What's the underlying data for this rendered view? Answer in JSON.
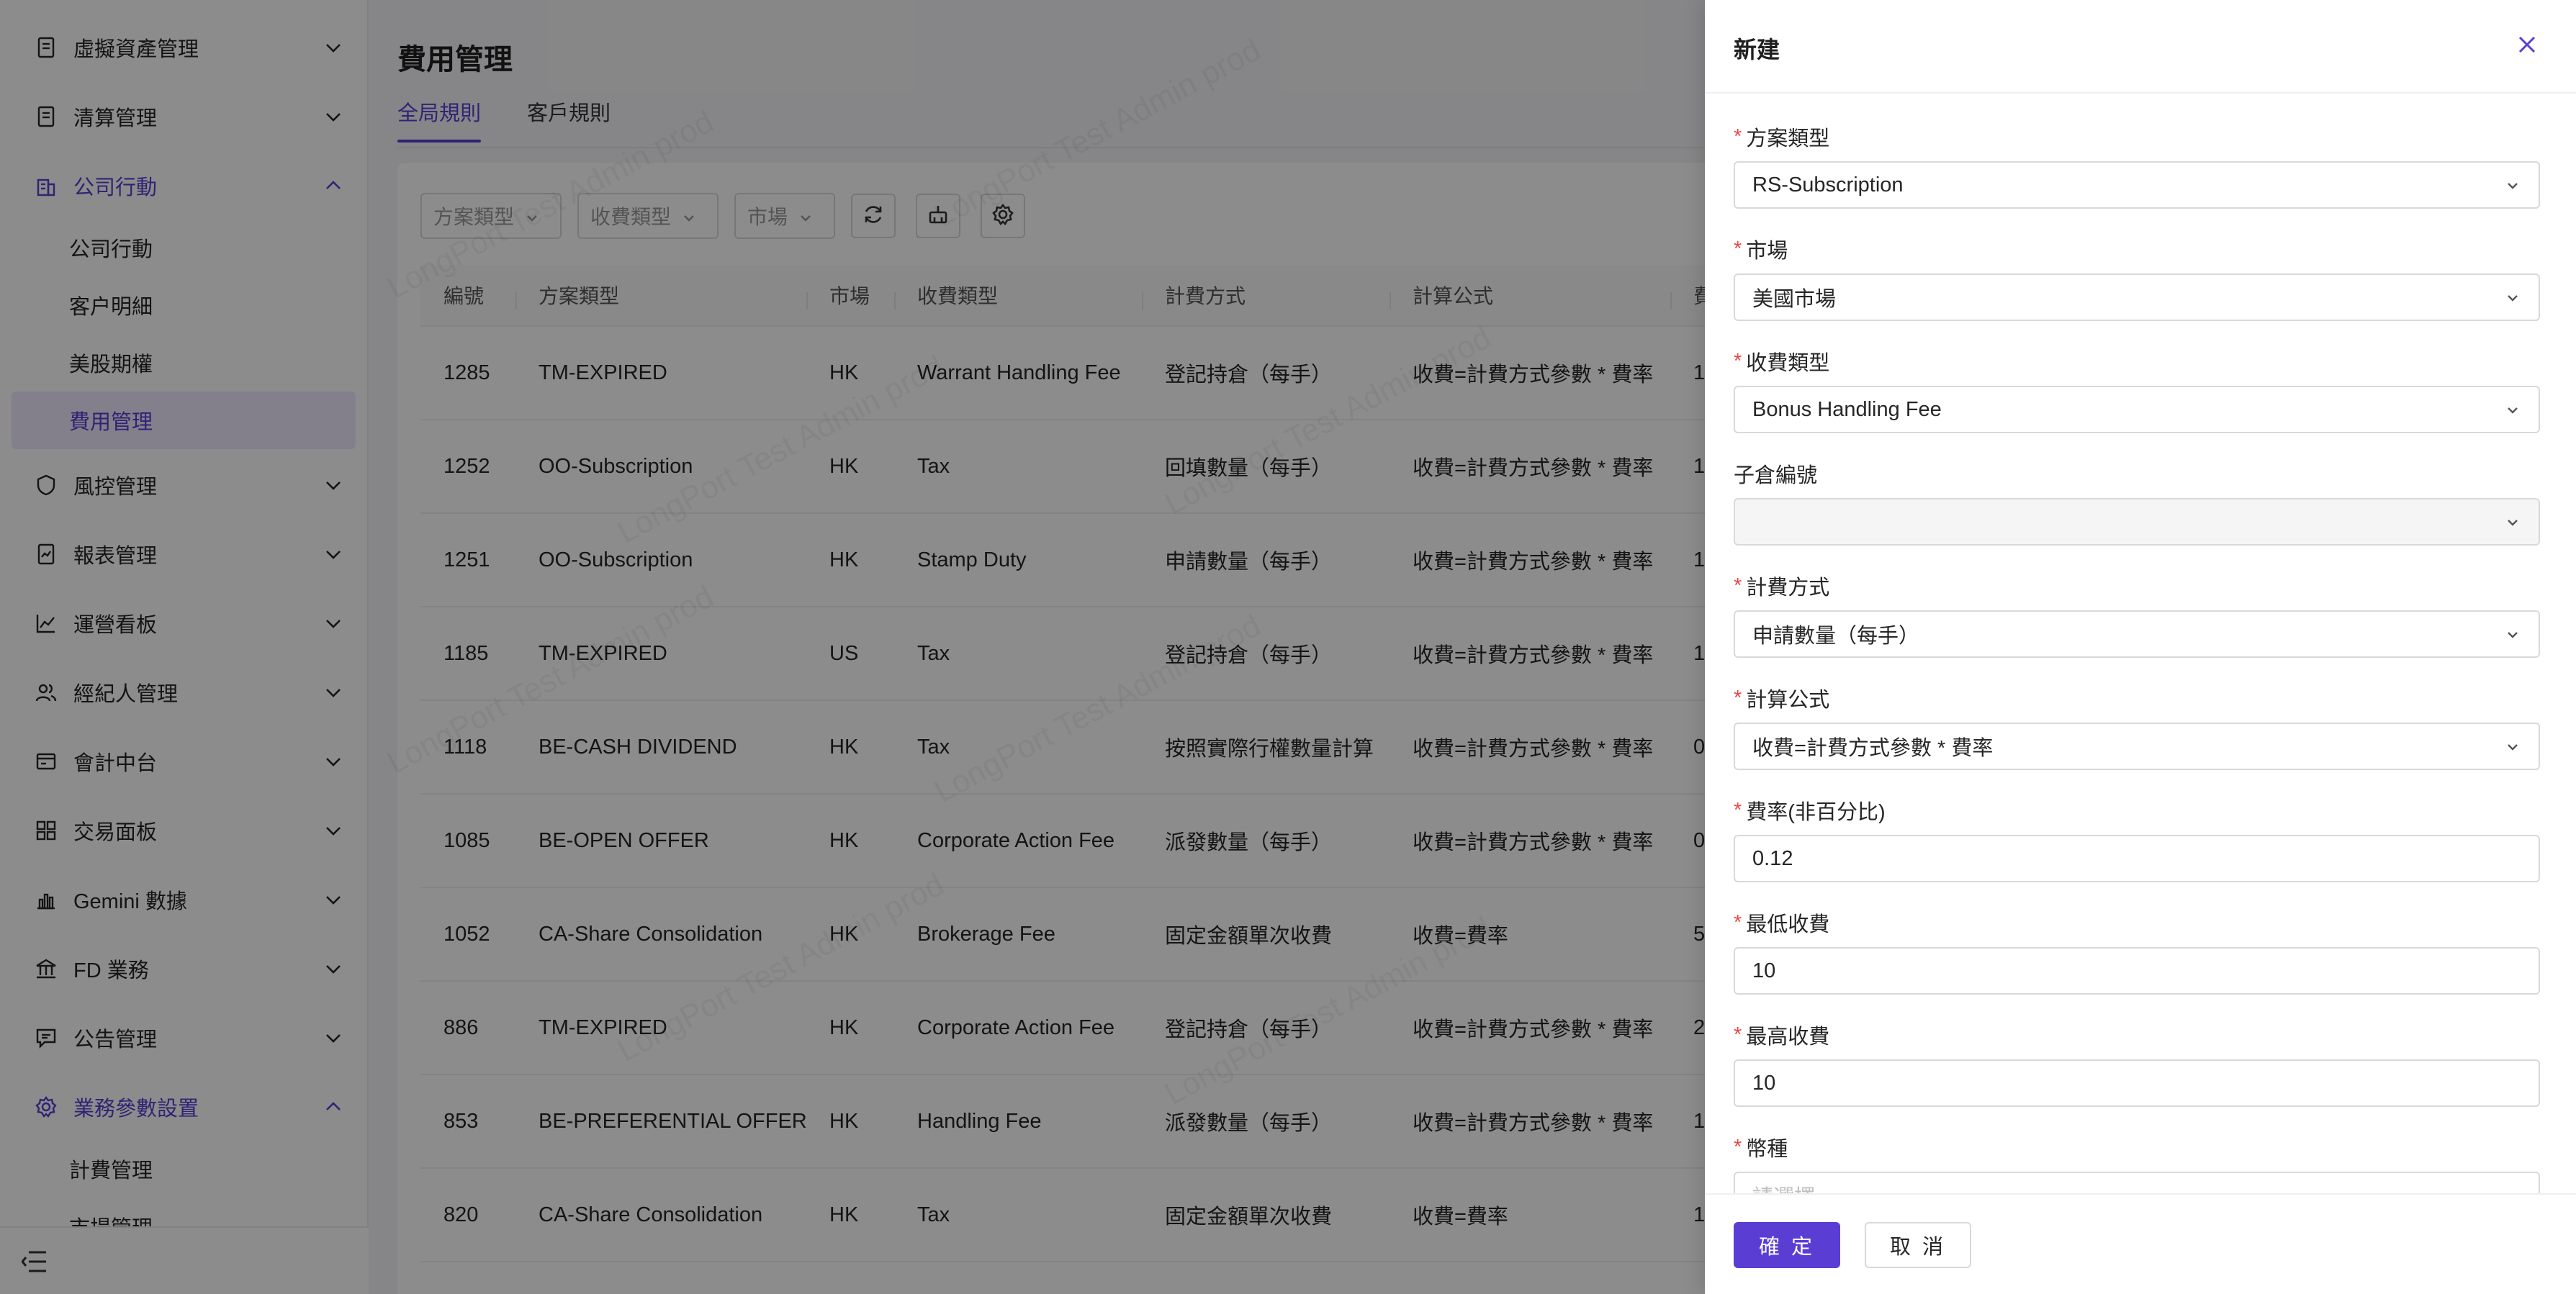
{
  "sidebar": {
    "items": [
      {
        "label": "虛擬資產管理",
        "icon": "document-icon"
      },
      {
        "label": "清算管理",
        "icon": "document-icon"
      },
      {
        "label": "公司行動",
        "icon": "building-icon",
        "open": true,
        "children": [
          "公司行動",
          "客户明細",
          "美股期權",
          "費用管理"
        ]
      },
      {
        "label": "風控管理",
        "icon": "shield-icon"
      },
      {
        "label": "報表管理",
        "icon": "report-icon"
      },
      {
        "label": "運營看板",
        "icon": "line-chart-icon"
      },
      {
        "label": "經紀人管理",
        "icon": "users-icon"
      },
      {
        "label": "會計中台",
        "icon": "ledger-icon"
      },
      {
        "label": "交易面板",
        "icon": "grid-icon"
      },
      {
        "label": "Gemini 數據",
        "icon": "bar-chart-icon"
      },
      {
        "label": "FD 業務",
        "icon": "bank-icon"
      },
      {
        "label": "公告管理",
        "icon": "message-icon"
      },
      {
        "label": "業務參數設置",
        "icon": "settings-icon",
        "open": true,
        "children": [
          "計費管理",
          "市場管理"
        ]
      }
    ],
    "active_sub": "費用管理"
  },
  "main": {
    "title": "費用管理",
    "tabs": [
      {
        "label": "全局規則",
        "active": true
      },
      {
        "label": "客戶規則",
        "active": false
      }
    ],
    "filters": [
      "方案類型",
      "收費類型",
      "市場"
    ],
    "watermark": "LongPort Test Admin prod"
  },
  "table": {
    "columns": [
      "編號",
      "方案類型",
      "市場",
      "收費類型",
      "計費方式",
      "計算公式",
      "費"
    ],
    "rows": [
      [
        "1285",
        "TM-EXPIRED",
        "HK",
        "Warrant Handling Fee",
        "登記持倉（每手）",
        "收費=計費方式參數 * 費率",
        "1"
      ],
      [
        "1252",
        "OO-Subscription",
        "HK",
        "Tax",
        "回填數量（每手）",
        "收費=計費方式參數 * 費率",
        "1"
      ],
      [
        "1251",
        "OO-Subscription",
        "HK",
        "Stamp Duty",
        "申請數量（每手）",
        "收費=計費方式參數 * 費率",
        "1"
      ],
      [
        "1185",
        "TM-EXPIRED",
        "US",
        "Tax",
        "登記持倉（每手）",
        "收費=計費方式參數 * 費率",
        "1"
      ],
      [
        "1118",
        "BE-CASH DIVIDEND",
        "HK",
        "Tax",
        "按照實際行權數量計算",
        "收費=計費方式參數 * 費率",
        "0"
      ],
      [
        "1085",
        "BE-OPEN OFFER",
        "HK",
        "Corporate Action Fee",
        "派發數量（每手）",
        "收費=計費方式參數 * 費率",
        "0"
      ],
      [
        "1052",
        "CA-Share Consolidation",
        "HK",
        "Brokerage Fee",
        "固定金額單次收費",
        "收費=費率",
        "5"
      ],
      [
        "886",
        "TM-EXPIRED",
        "HK",
        "Corporate Action Fee",
        "登記持倉（每手）",
        "收費=計費方式參數 * 費率",
        "2"
      ],
      [
        "853",
        "BE-PREFERENTIAL OFFER",
        "HK",
        "Handling Fee",
        "派發數量（每手）",
        "收費=計費方式參數 * 費率",
        "1"
      ],
      [
        "820",
        "CA-Share Consolidation",
        "HK",
        "Tax",
        "固定金額單次收費",
        "收費=費率",
        "1"
      ]
    ]
  },
  "drawer": {
    "title": "新建",
    "fields": [
      {
        "label": "方案類型",
        "required": true,
        "value": "RS-Subscription",
        "type": "select"
      },
      {
        "label": "市場",
        "required": true,
        "value": "美國市場",
        "type": "select"
      },
      {
        "label": "收費類型",
        "required": true,
        "value": "Bonus Handling Fee",
        "type": "select"
      },
      {
        "label": "子倉編號",
        "required": false,
        "value": "",
        "type": "select-disabled"
      },
      {
        "label": "計費方式",
        "required": true,
        "value": "申請數量（每手）",
        "type": "select"
      },
      {
        "label": "計算公式",
        "required": true,
        "value": "收費=計費方式參數 * 費率",
        "type": "select"
      },
      {
        "label": "費率(非百分比)",
        "required": true,
        "value": "0.12",
        "type": "input"
      },
      {
        "label": "最低收費",
        "required": true,
        "value": "10",
        "type": "input"
      },
      {
        "label": "最高收費",
        "required": true,
        "value": "10",
        "type": "input"
      },
      {
        "label": "幣種",
        "required": true,
        "value": "",
        "placeholder": "請選擇",
        "type": "select"
      }
    ],
    "ok_label": "確 定",
    "cancel_label": "取 消"
  },
  "colors": {
    "accent": "#5a3ed4",
    "required": "#e5484d",
    "mask": "rgba(0,0,0,0.45)"
  }
}
